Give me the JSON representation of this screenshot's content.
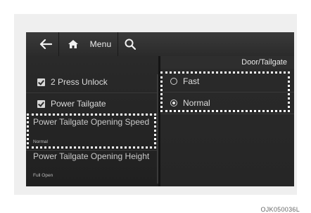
{
  "topbar": {
    "back_icon": "back-arrow-icon",
    "home_icon": "home-icon",
    "menu_label": "Menu",
    "search_icon": "search-icon"
  },
  "sidebar": {
    "items": [
      {
        "label": "2 Press Unlock",
        "checked": true
      },
      {
        "label": "Power Tailgate",
        "checked": true
      },
      {
        "label": "Power Tailgate Opening Speed",
        "value": "Normal"
      },
      {
        "label": "Power Tailgate Opening Height",
        "value": "Full Open"
      }
    ]
  },
  "content": {
    "title": "Door/Tailgate",
    "options": [
      {
        "label": "Fast",
        "selected": false
      },
      {
        "label": "Normal",
        "selected": true
      }
    ]
  },
  "caption": "OJK050036L",
  "colors": {
    "highlight_border": "#ffffff",
    "screen_bg": "#1f1f1f",
    "panel_bg": "#efefef"
  }
}
